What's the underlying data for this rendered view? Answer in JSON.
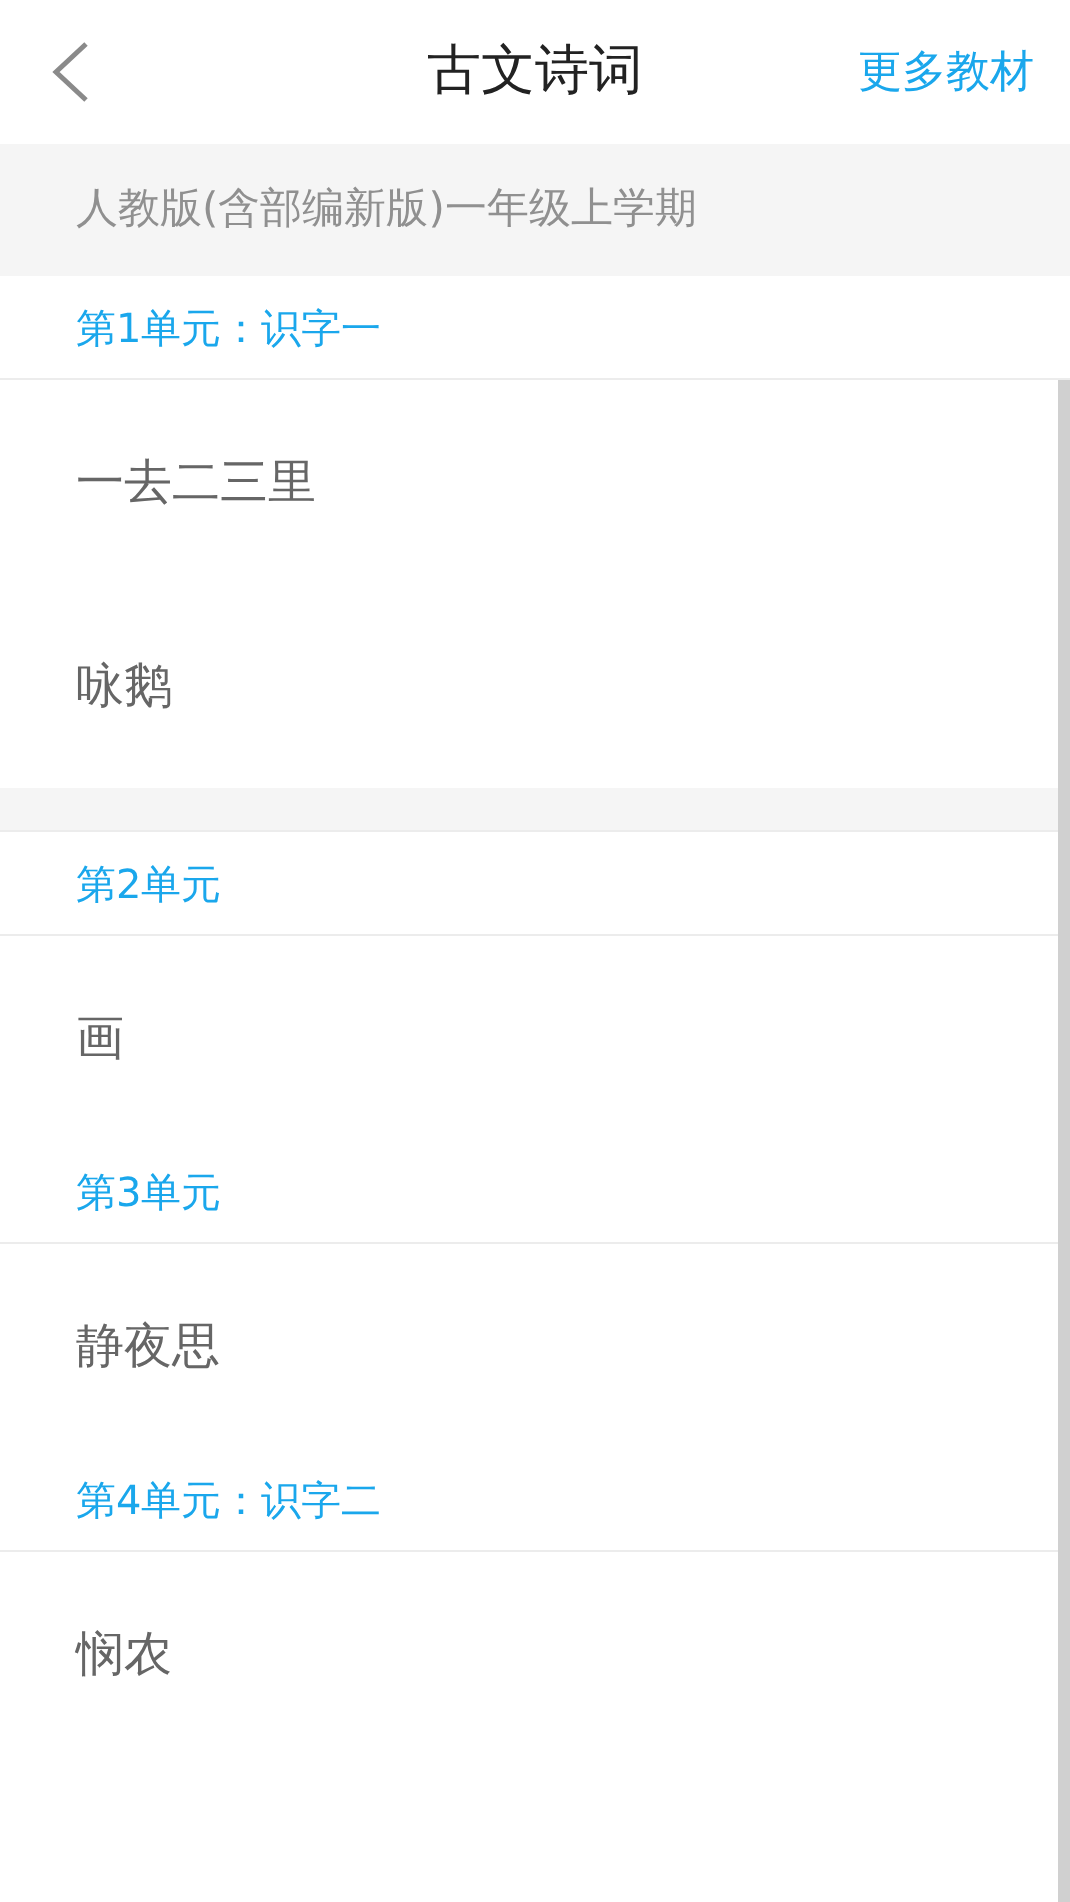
{
  "header": {
    "title": "古文诗词",
    "action": "更多教材"
  },
  "edition": "人教版(含部编新版)一年级上学期",
  "list": [
    {
      "kind": "unit",
      "label": "第1单元：识字一"
    },
    {
      "kind": "poem",
      "title": "一去二三里"
    },
    {
      "kind": "poem",
      "title": "咏鹅"
    },
    {
      "kind": "gap"
    },
    {
      "kind": "unit",
      "label": "第2单元"
    },
    {
      "kind": "poem",
      "title": "画"
    },
    {
      "kind": "unit",
      "label": "第3单元"
    },
    {
      "kind": "poem",
      "title": "静夜思"
    },
    {
      "kind": "unit",
      "label": "第4单元：识字二"
    },
    {
      "kind": "poem",
      "title": "悯农"
    }
  ]
}
